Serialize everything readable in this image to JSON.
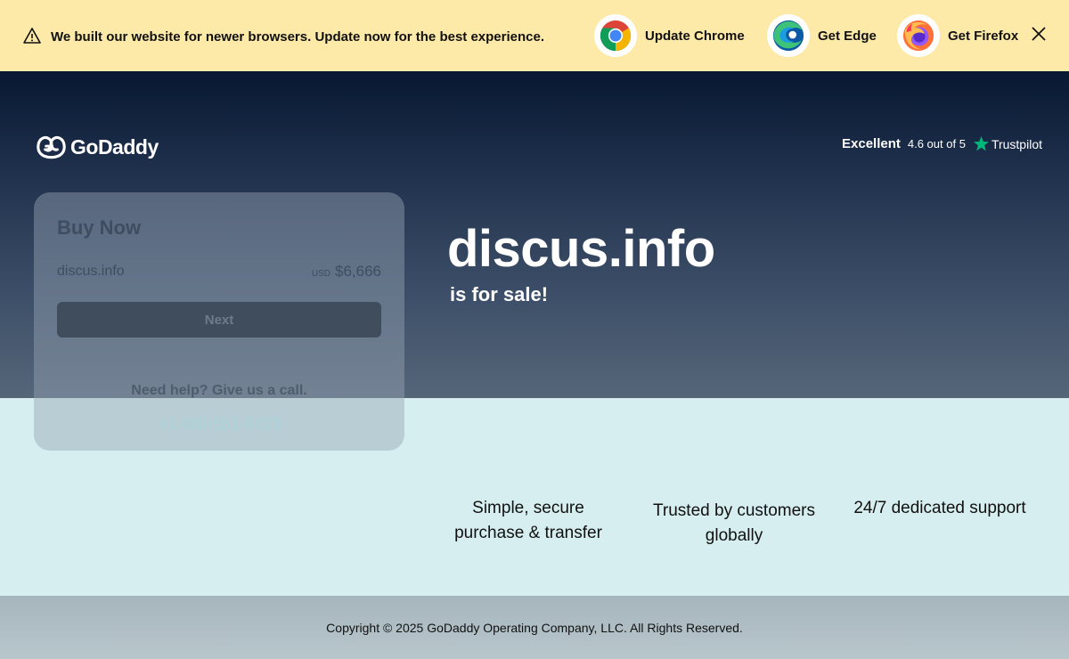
{
  "banner": {
    "message": "We built our website for newer browsers. Update now for the best experience.",
    "browsers": [
      {
        "label": "Update Chrome",
        "icon": "chrome-icon"
      },
      {
        "label": "Get Edge",
        "icon": "edge-icon"
      },
      {
        "label": "Get Firefox",
        "icon": "firefox-icon"
      }
    ],
    "icons": {
      "warning": "warning-icon",
      "close": "close-icon"
    },
    "background": "#fde9a8"
  },
  "header": {
    "logo_text": "GoDaddy",
    "trustpilot": {
      "rating_word": "Excellent",
      "score_text": "4.6 out of 5",
      "brand": "Trustpilot",
      "star_color": "#00b67a"
    }
  },
  "hero": {
    "domain": "discus.info",
    "subtitle": "is for sale!"
  },
  "buy_card": {
    "title": "Buy Now",
    "domain": "discus.info",
    "currency": "USD",
    "price": "$6,666",
    "next_label": "Next",
    "help_text": "Need help? Give us a call.",
    "phone": "+1 480-651-9713"
  },
  "features": [
    {
      "line1": "Simple, secure",
      "line2": "purchase & transfer"
    },
    {
      "line1": "Trusted by customers",
      "line2": "globally"
    },
    {
      "line1": "24/7 dedicated support",
      "line2": ""
    }
  ],
  "footer": {
    "copyright": "Copyright © 2025 GoDaddy Operating Company, LLC. All Rights Reserved."
  }
}
